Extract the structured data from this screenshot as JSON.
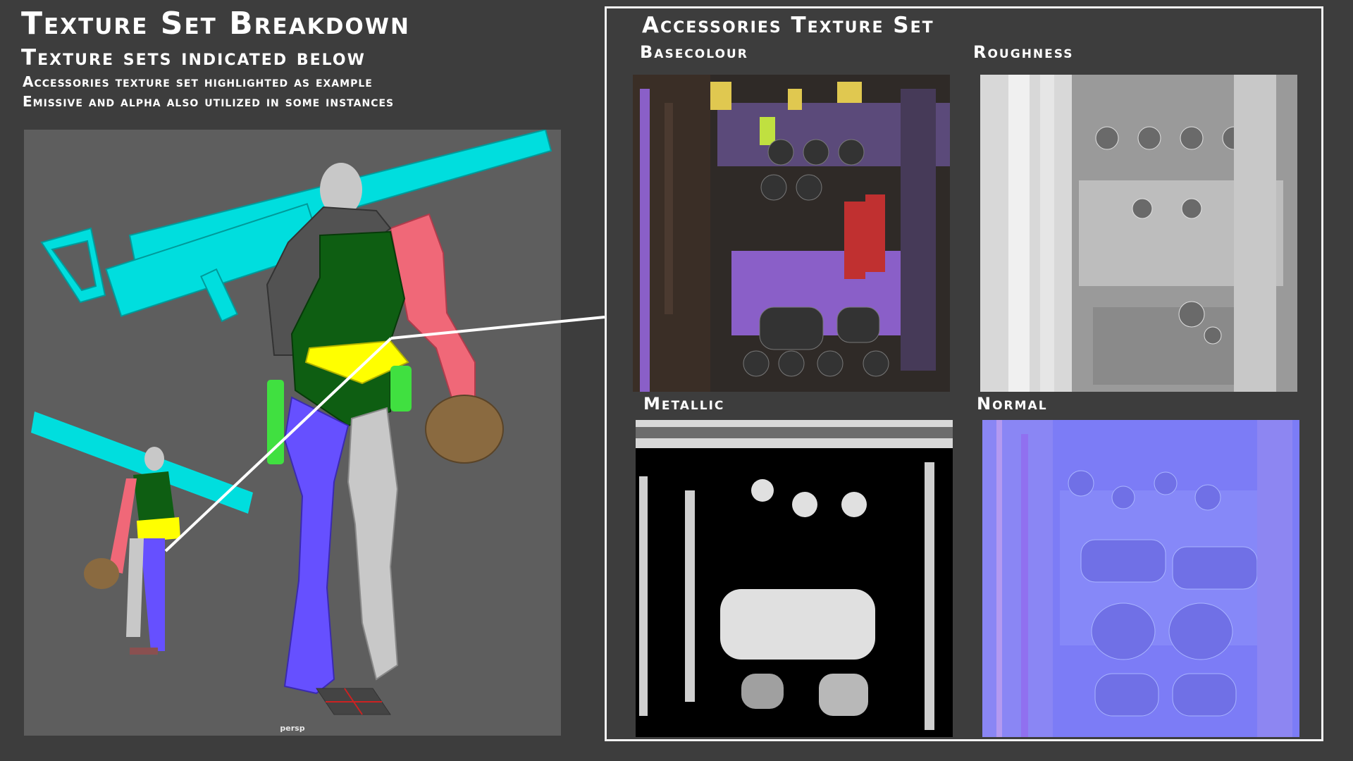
{
  "header": {
    "title": "Texture Set Breakdown",
    "subtitle": "Texture sets indicated below",
    "notes": [
      "Accessories texture set highlighted as example",
      "Emissive and alpha also utilized in some instances"
    ]
  },
  "viewport": {
    "camera_label": "persp"
  },
  "texture_panel": {
    "title": "Accessories Texture Set",
    "maps": [
      {
        "label": "Basecolour"
      },
      {
        "label": "Roughness"
      },
      {
        "label": "Metallic"
      },
      {
        "label": "Normal"
      }
    ]
  },
  "texture_set_colors": {
    "accessories": "#ffff00",
    "weapon": "#00e0e0",
    "arms": "#f06878",
    "torso": "#0e5e12",
    "legs": "#6450ff",
    "boots_armor": "#c8c8c8",
    "holsters": "#40e040",
    "helmet": "#8a6a40",
    "jacket": "#505050"
  }
}
